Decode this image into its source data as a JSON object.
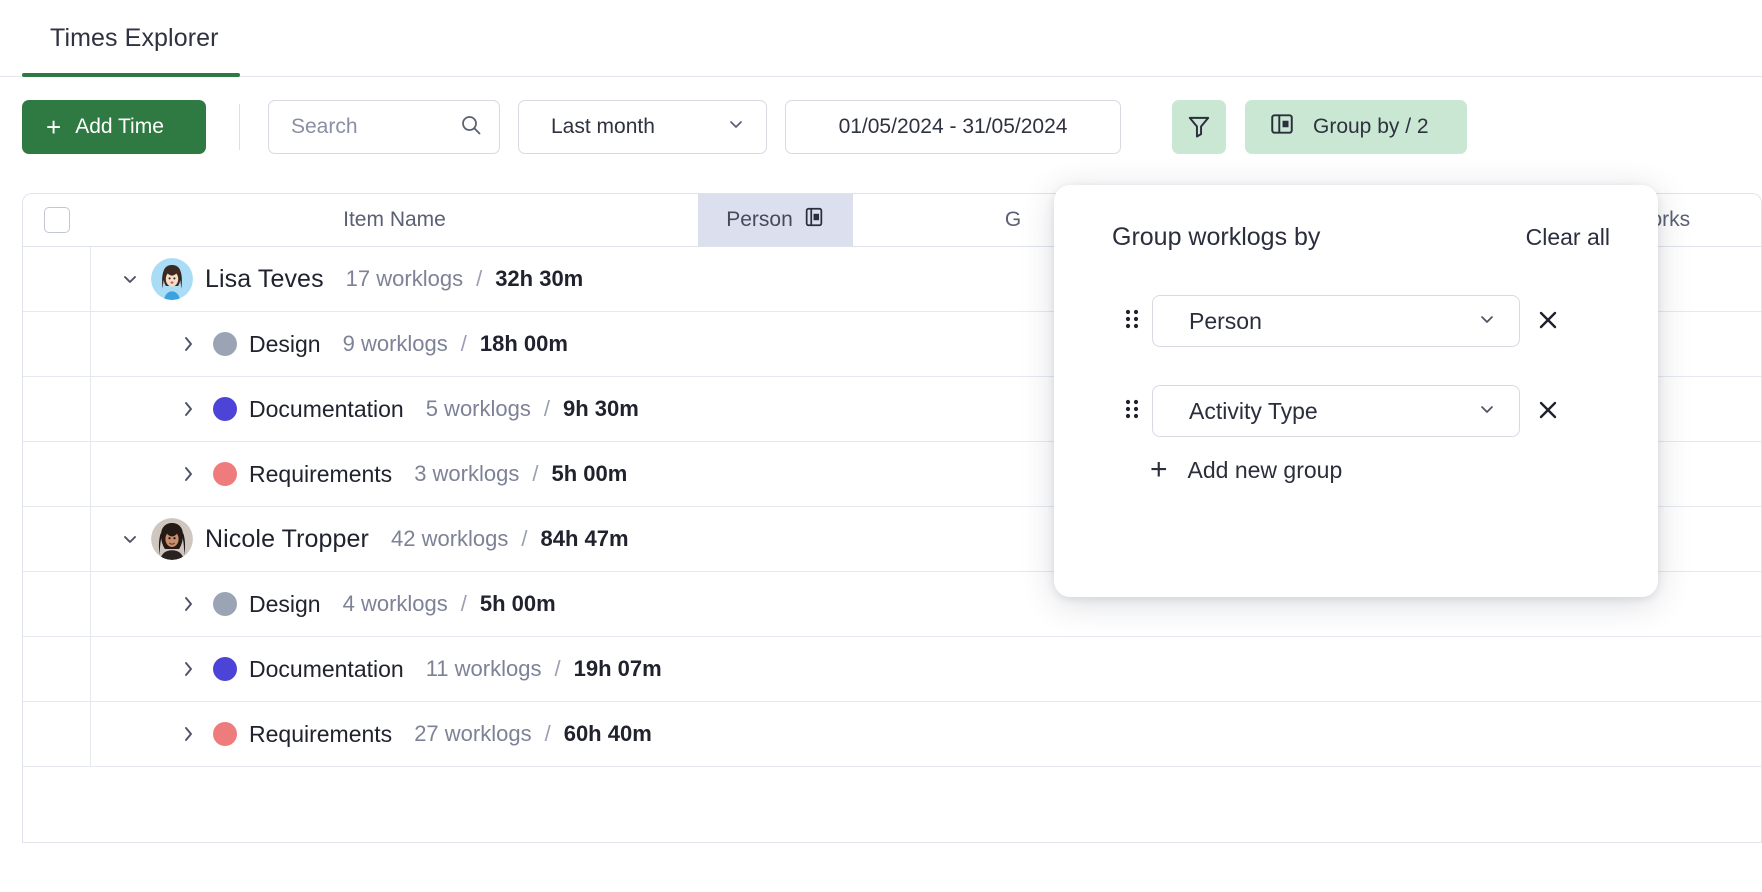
{
  "tab": {
    "label": "Times Explorer"
  },
  "toolbar": {
    "add_time_label": "Add Time",
    "add_time_icon": "plus-icon",
    "search_placeholder": "Search",
    "search_icon": "search-icon",
    "period_value": "Last month",
    "period_chevron_icon": "chevron-down-icon",
    "date_range": "01/05/2024 - 31/05/2024",
    "filter_icon": "funnel-icon",
    "group_by_label": "Group by / 2",
    "group_by_icon": "panel-layout-icon"
  },
  "table": {
    "columns": [
      {
        "key": "checkbox",
        "label": "",
        "icon": "checkbox-icon"
      },
      {
        "key": "item_name",
        "label": "Item Name"
      },
      {
        "key": "person",
        "label": "Person",
        "icon": "panel-layout-icon",
        "highlighted": true
      },
      {
        "key": "group",
        "label": "G"
      },
      {
        "key": "worklogs",
        "label": "Works"
      }
    ],
    "rows": [
      {
        "level": 1,
        "type": "person",
        "expanded": true,
        "caret_icon": "chevron-down-icon",
        "avatar": "avatar-lisa",
        "name": "Lisa Teves",
        "worklogs": "17 worklogs",
        "separator": "/",
        "duration": "32h 30m"
      },
      {
        "level": 2,
        "type": "activity",
        "expanded": false,
        "caret_icon": "chevron-right-icon",
        "dot_color": "#9aa4b5",
        "name": "Design",
        "worklogs": "9 worklogs",
        "separator": "/",
        "duration": "18h 00m"
      },
      {
        "level": 2,
        "type": "activity",
        "expanded": false,
        "caret_icon": "chevron-right-icon",
        "dot_color": "#4b44d6",
        "name": "Documentation",
        "worklogs": "5 worklogs",
        "separator": "/",
        "duration": "9h 30m"
      },
      {
        "level": 2,
        "type": "activity",
        "expanded": false,
        "caret_icon": "chevron-right-icon",
        "dot_color": "#ef7c7c",
        "name": "Requirements",
        "worklogs": "3 worklogs",
        "separator": "/",
        "duration": "5h 00m"
      },
      {
        "level": 1,
        "type": "person",
        "expanded": true,
        "caret_icon": "chevron-down-icon",
        "avatar": "avatar-nicole",
        "name": "Nicole Tropper",
        "worklogs": "42 worklogs",
        "separator": "/",
        "duration": "84h 47m"
      },
      {
        "level": 2,
        "type": "activity",
        "expanded": false,
        "caret_icon": "chevron-right-icon",
        "dot_color": "#9aa4b5",
        "name": "Design",
        "worklogs": "4 worklogs",
        "separator": "/",
        "duration": "5h 00m"
      },
      {
        "level": 2,
        "type": "activity",
        "expanded": false,
        "caret_icon": "chevron-right-icon",
        "dot_color": "#4b44d6",
        "name": "Documentation",
        "worklogs": "11 worklogs",
        "separator": "/",
        "duration": "19h 07m"
      },
      {
        "level": 2,
        "type": "activity",
        "expanded": false,
        "caret_icon": "chevron-right-icon",
        "dot_color": "#ef7c7c",
        "name": "Requirements",
        "worklogs": "27 worklogs",
        "separator": "/",
        "duration": "60h 40m"
      }
    ]
  },
  "popup": {
    "title": "Group worklogs by",
    "clear_all_label": "Clear all",
    "groups": [
      {
        "value": "Person",
        "grip_icon": "drag-handle-icon",
        "chevron_icon": "chevron-down-icon",
        "remove_icon": "close-icon"
      },
      {
        "value": "Activity Type",
        "grip_icon": "drag-handle-icon",
        "chevron_icon": "chevron-down-icon",
        "remove_icon": "close-icon"
      }
    ],
    "add_new_label": "Add new group",
    "add_new_icon": "plus-icon"
  },
  "colors": {
    "brand_green": "#2f7a42",
    "chip_green": "#c9e7d2",
    "person_header": "#dbdfee"
  }
}
